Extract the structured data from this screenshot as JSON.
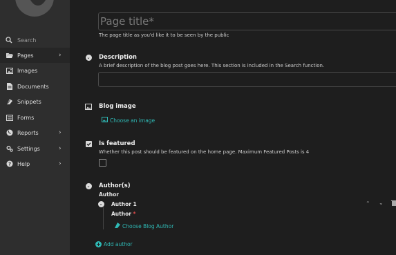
{
  "sidebar": {
    "search_placeholder": "Search",
    "items": [
      {
        "label": "Pages",
        "icon": "folder-open-icon",
        "has_submenu": true
      },
      {
        "label": "Images",
        "icon": "image-icon",
        "has_submenu": false
      },
      {
        "label": "Documents",
        "icon": "document-icon",
        "has_submenu": false
      },
      {
        "label": "Snippets",
        "icon": "snippet-icon",
        "has_submenu": false
      },
      {
        "label": "Forms",
        "icon": "form-icon",
        "has_submenu": false
      },
      {
        "label": "Reports",
        "icon": "globe-icon",
        "has_submenu": true
      },
      {
        "label": "Settings",
        "icon": "cog-icon",
        "has_submenu": true
      },
      {
        "label": "Help",
        "icon": "help-icon",
        "has_submenu": true
      }
    ]
  },
  "form": {
    "title": {
      "placeholder": "Page title*",
      "help": "The page title as you'd like it to be seen by the public"
    },
    "description": {
      "label": "Description",
      "help": "A brief description of the blog post goes here. This section is included in the Search function.",
      "value": ""
    },
    "blog_image": {
      "label": "Blog image",
      "choose": "Choose an image"
    },
    "is_featured": {
      "label": "Is featured",
      "help": "Whether this post should be featured on the home page. Maximum Featured Posts is 4",
      "checked": false
    },
    "authors": {
      "label": "Author(s)",
      "field_label": "Author",
      "entry_title": "Author 1",
      "entry_field_label": "Author",
      "required_mark": "*",
      "choose": "Choose Blog Author",
      "add": "Add author"
    }
  },
  "colors": {
    "accent": "#2fb9b5",
    "required": "#e14b4b",
    "sidebar_bg": "#2e2e2e",
    "main_bg": "#1e1e1e"
  }
}
